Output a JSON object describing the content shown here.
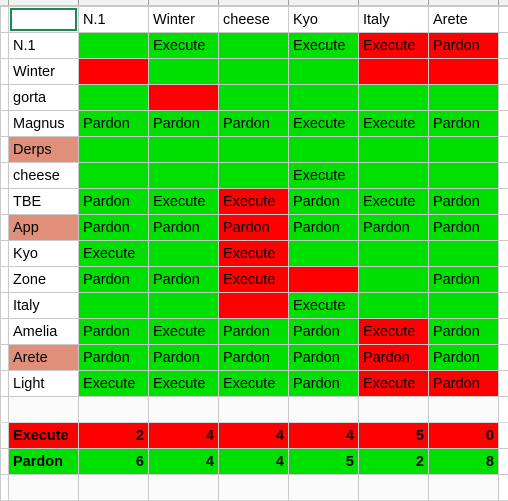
{
  "app": {
    "type": "spreadsheet",
    "colors": {
      "execute_fill": "#ff0000",
      "pardon_fill": "#00e000",
      "highlight_name_fill": "#e0907a",
      "selection_border": "#1a8a54",
      "grid_line": "#c9c9c9"
    }
  },
  "top_strip": {
    "partial_column_headers": [
      "",
      "",
      "",
      "",
      ""
    ]
  },
  "table": {
    "corner_cell": "",
    "column_headers": [
      "N.1",
      "Winter",
      "cheese",
      "Kyo",
      "Italy",
      "Arete"
    ],
    "rows": [
      {
        "label": "N.1",
        "label_fill": "white",
        "cells": [
          {
            "text": "",
            "fill": "green"
          },
          {
            "text": "Execute",
            "fill": "green"
          },
          {
            "text": "",
            "fill": "green"
          },
          {
            "text": "Execute",
            "fill": "green"
          },
          {
            "text": "Execute",
            "fill": "red"
          },
          {
            "text": "Pardon",
            "fill": "red"
          }
        ]
      },
      {
        "label": "Winter",
        "label_fill": "white",
        "cells": [
          {
            "text": "",
            "fill": "red"
          },
          {
            "text": "",
            "fill": "green"
          },
          {
            "text": "",
            "fill": "green"
          },
          {
            "text": "",
            "fill": "green"
          },
          {
            "text": "",
            "fill": "red"
          },
          {
            "text": "",
            "fill": "red"
          }
        ]
      },
      {
        "label": "gorta",
        "label_fill": "white",
        "cells": [
          {
            "text": "",
            "fill": "green"
          },
          {
            "text": "",
            "fill": "red"
          },
          {
            "text": "",
            "fill": "green"
          },
          {
            "text": "",
            "fill": "green"
          },
          {
            "text": "",
            "fill": "green"
          },
          {
            "text": "",
            "fill": "green"
          }
        ]
      },
      {
        "label": "Magnus",
        "label_fill": "white",
        "cells": [
          {
            "text": "Pardon",
            "fill": "green"
          },
          {
            "text": "Pardon",
            "fill": "green"
          },
          {
            "text": "Pardon",
            "fill": "green"
          },
          {
            "text": "Execute",
            "fill": "green"
          },
          {
            "text": "Execute",
            "fill": "green"
          },
          {
            "text": "Pardon",
            "fill": "green"
          }
        ]
      },
      {
        "label": "Derps",
        "label_fill": "salmon",
        "cells": [
          {
            "text": "",
            "fill": "green"
          },
          {
            "text": "",
            "fill": "green"
          },
          {
            "text": "",
            "fill": "green"
          },
          {
            "text": "",
            "fill": "green"
          },
          {
            "text": "",
            "fill": "green"
          },
          {
            "text": "",
            "fill": "green"
          }
        ]
      },
      {
        "label": "cheese",
        "label_fill": "white",
        "cells": [
          {
            "text": "",
            "fill": "green"
          },
          {
            "text": "",
            "fill": "green"
          },
          {
            "text": "",
            "fill": "green"
          },
          {
            "text": "Execute",
            "fill": "green"
          },
          {
            "text": "",
            "fill": "green"
          },
          {
            "text": "",
            "fill": "green"
          }
        ]
      },
      {
        "label": "TBE",
        "label_fill": "white",
        "cells": [
          {
            "text": "Pardon",
            "fill": "green"
          },
          {
            "text": "Execute",
            "fill": "green"
          },
          {
            "text": "Execute",
            "fill": "red"
          },
          {
            "text": "Pardon",
            "fill": "green"
          },
          {
            "text": "Execute",
            "fill": "green"
          },
          {
            "text": "Pardon",
            "fill": "green"
          }
        ]
      },
      {
        "label": "App",
        "label_fill": "salmon",
        "cells": [
          {
            "text": "Pardon",
            "fill": "green"
          },
          {
            "text": "Pardon",
            "fill": "green"
          },
          {
            "text": "Pardon",
            "fill": "red"
          },
          {
            "text": "Pardon",
            "fill": "green"
          },
          {
            "text": "Pardon",
            "fill": "green"
          },
          {
            "text": "Pardon",
            "fill": "green"
          }
        ]
      },
      {
        "label": "Kyo",
        "label_fill": "white",
        "cells": [
          {
            "text": "Execute",
            "fill": "green"
          },
          {
            "text": "",
            "fill": "green"
          },
          {
            "text": "Execute",
            "fill": "red"
          },
          {
            "text": "",
            "fill": "green"
          },
          {
            "text": "",
            "fill": "green"
          },
          {
            "text": "",
            "fill": "green"
          }
        ]
      },
      {
        "label": "Zone",
        "label_fill": "white",
        "cells": [
          {
            "text": "Pardon",
            "fill": "green"
          },
          {
            "text": "Pardon",
            "fill": "green"
          },
          {
            "text": "Execute",
            "fill": "red"
          },
          {
            "text": "",
            "fill": "red"
          },
          {
            "text": "",
            "fill": "green"
          },
          {
            "text": "Pardon",
            "fill": "green"
          }
        ]
      },
      {
        "label": "Italy",
        "label_fill": "white",
        "cells": [
          {
            "text": "",
            "fill": "green"
          },
          {
            "text": "",
            "fill": "green"
          },
          {
            "text": "",
            "fill": "red"
          },
          {
            "text": "Execute",
            "fill": "green"
          },
          {
            "text": "",
            "fill": "green"
          },
          {
            "text": "",
            "fill": "green"
          }
        ]
      },
      {
        "label": "Amelia",
        "label_fill": "white",
        "cells": [
          {
            "text": "Pardon",
            "fill": "green"
          },
          {
            "text": "Execute",
            "fill": "green"
          },
          {
            "text": "Pardon",
            "fill": "green"
          },
          {
            "text": "Pardon",
            "fill": "green"
          },
          {
            "text": "Execute",
            "fill": "red"
          },
          {
            "text": "Pardon",
            "fill": "green"
          }
        ]
      },
      {
        "label": "Arete",
        "label_fill": "salmon",
        "cells": [
          {
            "text": "Pardon",
            "fill": "green"
          },
          {
            "text": "Pardon",
            "fill": "green"
          },
          {
            "text": "Pardon",
            "fill": "green"
          },
          {
            "text": "Pardon",
            "fill": "green"
          },
          {
            "text": "Pardon",
            "fill": "red"
          },
          {
            "text": "Pardon",
            "fill": "green"
          }
        ]
      },
      {
        "label": "Light",
        "label_fill": "white",
        "cells": [
          {
            "text": "Execute",
            "fill": "green"
          },
          {
            "text": "Execute",
            "fill": "green"
          },
          {
            "text": "Execute",
            "fill": "green"
          },
          {
            "text": "Pardon",
            "fill": "green"
          },
          {
            "text": "Execute",
            "fill": "red"
          },
          {
            "text": "Pardon",
            "fill": "red"
          }
        ]
      }
    ],
    "summary": [
      {
        "label": "Execute",
        "fill": "red",
        "values": [
          "2",
          "4",
          "4",
          "4",
          "5",
          "0"
        ]
      },
      {
        "label": "Pardon",
        "fill": "green",
        "values": [
          "6",
          "4",
          "4",
          "5",
          "2",
          "8"
        ]
      }
    ]
  }
}
